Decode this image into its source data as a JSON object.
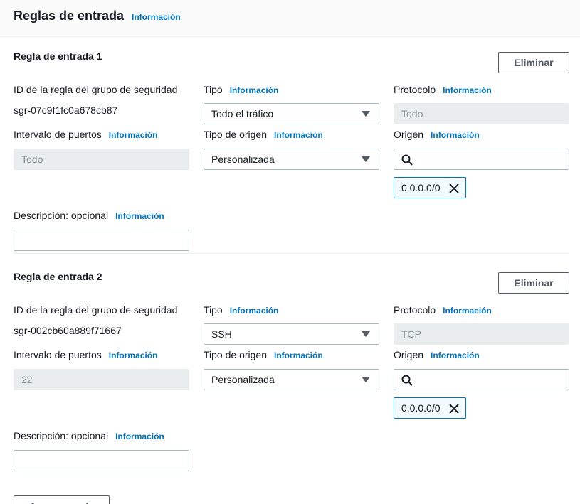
{
  "header": {
    "title": "Reglas de entrada",
    "info": "Información"
  },
  "labels": {
    "rule_id": "ID de la regla del grupo de seguridad",
    "type": "Tipo",
    "protocol": "Protocolo",
    "port_range": "Intervalo de puertos",
    "source_type": "Tipo de origen",
    "source": "Origen",
    "description": "Descripción: opcional",
    "info": "Información",
    "delete": "Eliminar"
  },
  "rules": [
    {
      "title": "Regla de entrada 1",
      "rule_id": "sgr-07c9f1fc0a678cb87",
      "type": "Todo el tráfico",
      "protocol": "Todo",
      "port_range": "Todo",
      "source_type": "Personalizada",
      "source_search": "",
      "source_token": "0.0.0.0/0",
      "description": ""
    },
    {
      "title": "Regla de entrada 2",
      "rule_id": "sgr-002cb60a889f71667",
      "type": "SSH",
      "protocol": "TCP",
      "port_range": "22",
      "source_type": "Personalizada",
      "source_search": "",
      "source_token": "0.0.0.0/0",
      "description": ""
    }
  ],
  "footer": {
    "add_rule_label": "Agregar regla"
  },
  "icons": {
    "search": "search-icon",
    "caret": "caret-down-icon",
    "remove": "close-icon"
  },
  "colors": {
    "link": "#0073bb",
    "token_border": "#0073bb",
    "disabled_bg": "#eaeded"
  }
}
